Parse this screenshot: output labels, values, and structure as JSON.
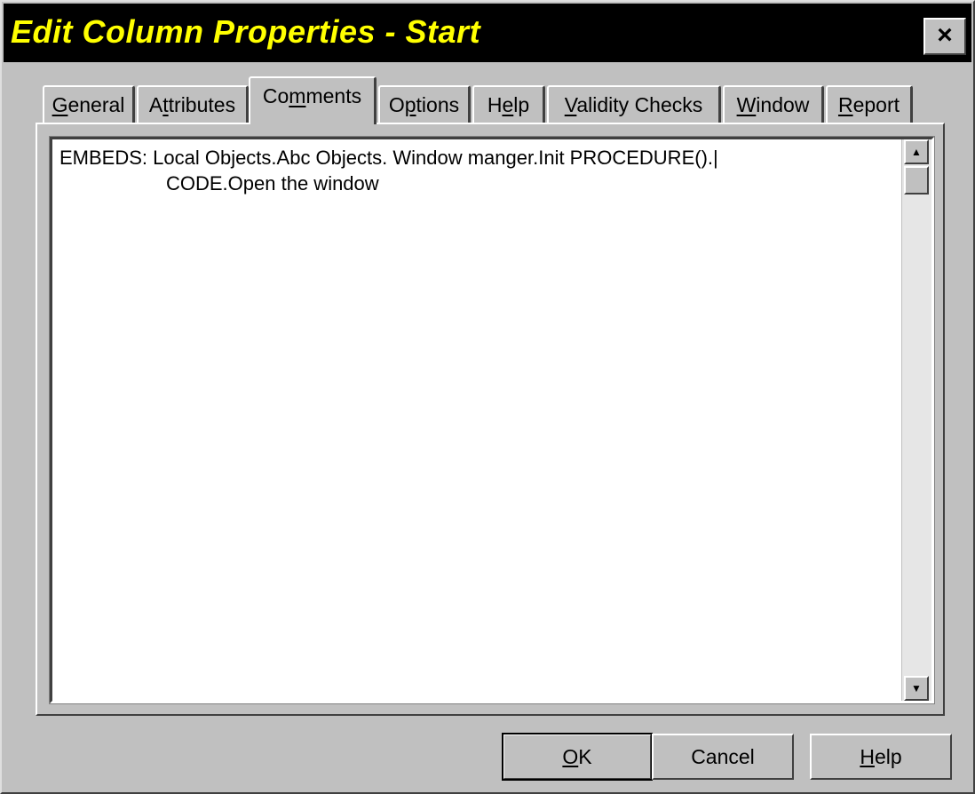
{
  "window": {
    "title": "Edit Column Properties - Start",
    "close_label": "×"
  },
  "tabs": [
    {
      "pre": "",
      "u": "G",
      "post": "eneral",
      "active": false
    },
    {
      "pre": "A",
      "u": "t",
      "post": "tributes",
      "active": false
    },
    {
      "pre": "Co",
      "u": "m",
      "post": "ments",
      "active": true
    },
    {
      "pre": "O",
      "u": "p",
      "post": "tions",
      "active": false
    },
    {
      "pre": "H",
      "u": "e",
      "post": "lp",
      "active": false
    },
    {
      "pre": "",
      "u": "V",
      "post": "alidity Checks",
      "active": false
    },
    {
      "pre": "",
      "u": "W",
      "post": "indow",
      "active": false
    },
    {
      "pre": "",
      "u": "R",
      "post": "eport",
      "active": false
    }
  ],
  "comments": {
    "line1": "EMBEDS: Local Objects.Abc Objects. Window manger.Init PROCEDURE().|",
    "line2": "CODE.Open the window"
  },
  "scrollbar": {
    "up_arrow": "▲",
    "down_arrow": "▼"
  },
  "buttons": {
    "ok": {
      "u": "O",
      "post": "K"
    },
    "cancel": {
      "label": "Cancel"
    },
    "help": {
      "u": "H",
      "post": "elp"
    }
  }
}
